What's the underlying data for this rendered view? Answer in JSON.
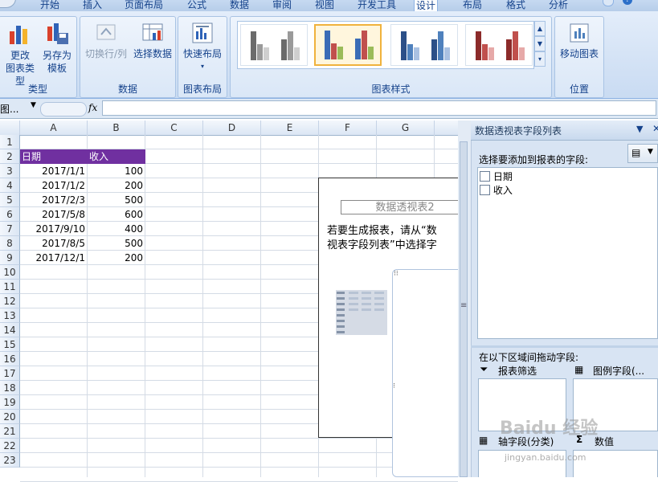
{
  "ribbon": {
    "tabs": [
      "开始",
      "插入",
      "页面布局",
      "公式",
      "数据",
      "审阅",
      "视图",
      "开发工具",
      "设计",
      "布局",
      "格式",
      "分析"
    ],
    "active_tab": "设计",
    "groups": {
      "type": {
        "label": "类型",
        "change_type": [
          "更改",
          "图表类型"
        ],
        "save_template": [
          "另存为",
          "模板"
        ]
      },
      "data": {
        "label": "数据",
        "switch_row_col": "切换行/列",
        "select_data": "选择数据"
      },
      "layout": {
        "label": "图表布局",
        "quick_layout": "快速布局"
      },
      "styles": {
        "label": "图表样式"
      },
      "location": {
        "label": "位置",
        "move_chart": "移动图表"
      }
    }
  },
  "formula_bar": {
    "name_box": "图...",
    "fx": "fx",
    "formula": ""
  },
  "sheet": {
    "columns": [
      "A",
      "B",
      "C",
      "D",
      "E",
      "F",
      "G"
    ],
    "rows": [
      "1",
      "2",
      "3",
      "4",
      "5",
      "6",
      "7",
      "8",
      "9",
      "10",
      "11",
      "12",
      "13",
      "14",
      "15",
      "16",
      "17",
      "18",
      "19",
      "20",
      "21",
      "22",
      "23"
    ],
    "headers": [
      "日期",
      "收入"
    ],
    "data": [
      [
        "2017/1/1",
        "100"
      ],
      [
        "2017/1/2",
        "200"
      ],
      [
        "2017/2/3",
        "500"
      ],
      [
        "2017/5/8",
        "600"
      ],
      [
        "2017/9/10",
        "400"
      ],
      [
        "2017/8/5",
        "500"
      ],
      [
        "2017/12/1",
        "200"
      ]
    ]
  },
  "pivot": {
    "title": "数据透视表2",
    "instructions": [
      "若要生成报表，请从“数",
      "视表字段列表”中选择字"
    ]
  },
  "pane": {
    "title": "数据透视表字段列表",
    "choose_label": "选择要添加到报表的字段:",
    "fields": [
      "日期",
      "收入"
    ],
    "drag_label": "在以下区域间拖动字段:",
    "report_filter": "报表筛选",
    "legend_fields": "图例字段(...",
    "axis_fields": "轴字段(分类)",
    "values": "数值"
  },
  "watermark": {
    "main": "Baidu 经验",
    "sub": "jingyan.baidu.com"
  },
  "colors": {
    "header_fill": "#7030a0",
    "ribbon_text": "#15428b",
    "pane_bg": "#d8e4f3"
  }
}
